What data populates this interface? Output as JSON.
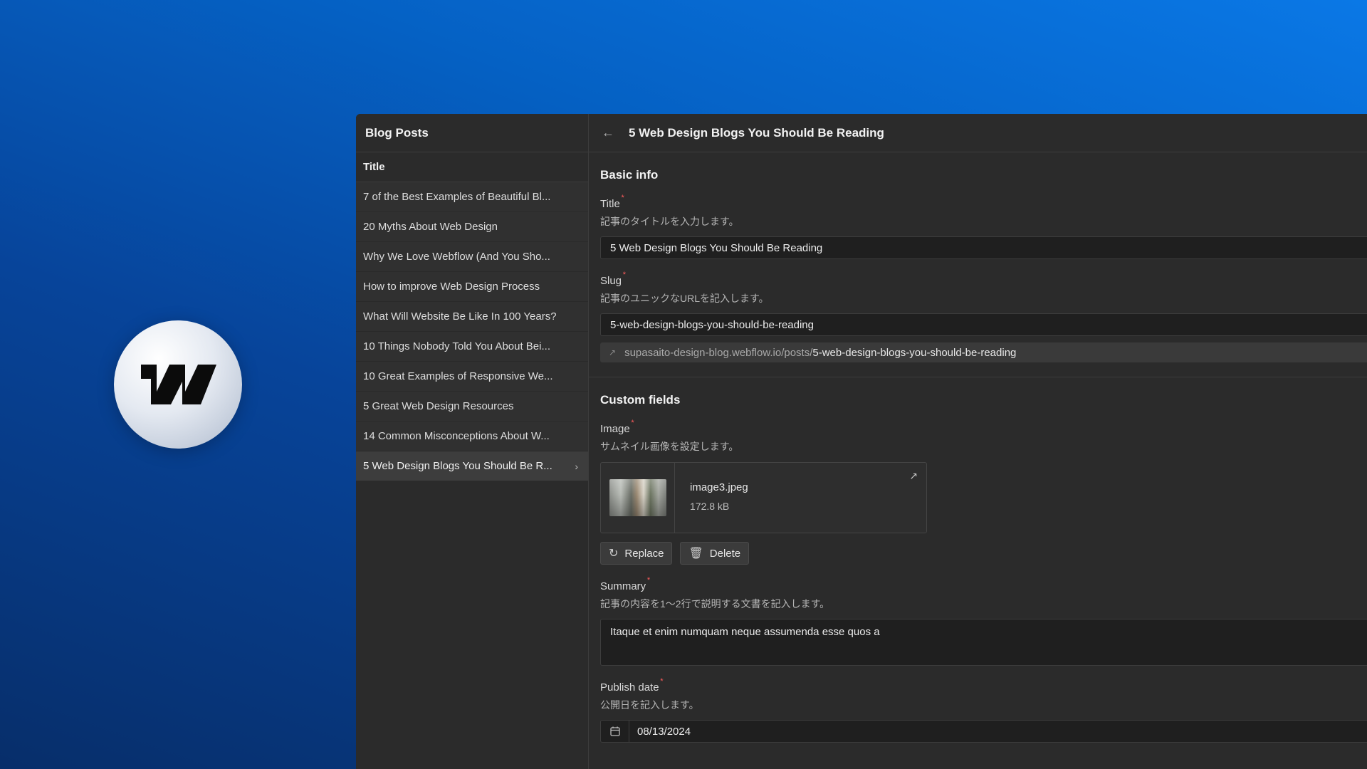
{
  "sidebar": {
    "title": "Blog Posts",
    "column_header": "Title",
    "items": [
      {
        "label": "7 of the Best Examples of Beautiful Bl..."
      },
      {
        "label": "20 Myths About Web Design"
      },
      {
        "label": "Why We Love Webflow (And You Sho..."
      },
      {
        "label": "How to improve Web Design Process"
      },
      {
        "label": "What Will Website Be Like In 100 Years?"
      },
      {
        "label": "10 Things Nobody Told You About Bei..."
      },
      {
        "label": "10 Great Examples of Responsive We..."
      },
      {
        "label": "5 Great Web Design Resources"
      },
      {
        "label": "14 Common Misconceptions About W..."
      },
      {
        "label": "5 Web Design Blogs You Should Be R..."
      }
    ],
    "selected_index": 9
  },
  "editor": {
    "title": "5 Web Design Blogs You Should Be Reading",
    "basic_info": {
      "heading": "Basic info",
      "title_field": {
        "label": "Title",
        "hint": "記事のタイトルを入力します。",
        "value": "5 Web Design Blogs You Should Be Reading"
      },
      "slug_field": {
        "label": "Slug",
        "hint": "記事のユニックなURLを記入します。",
        "value": "5-web-design-blogs-you-should-be-reading",
        "url_base": "supasaito-design-blog.webflow.io/posts/",
        "url_slug": "5-web-design-blogs-you-should-be-reading"
      }
    },
    "custom_fields": {
      "heading": "Custom fields",
      "image_field": {
        "label": "Image",
        "hint": "サムネイル画像を設定します。",
        "file_name": "image3.jpeg",
        "file_size": "172.8 kB",
        "replace_label": "Replace",
        "delete_label": "Delete"
      },
      "summary_field": {
        "label": "Summary",
        "hint": "記事の内容を1〜2行で説明する文書を記入します。",
        "value": "Itaque et enim numquam neque assumenda esse quos a"
      },
      "publish_date_field": {
        "label": "Publish date",
        "hint": "公開日を記入します。",
        "value": "08/13/2024"
      }
    },
    "required_marker": "*"
  },
  "colors": {
    "background_top": "#0a78e6",
    "background_bottom": "#072e6a",
    "panel": "#2b2b2b",
    "required": "#ff5c5c"
  },
  "icons": {
    "logo": "webflow-logo",
    "back": "arrow-left-icon",
    "chevron": "chevron-right-icon",
    "link": "link-icon",
    "open": "arrow-up-right-icon",
    "replace": "refresh-icon",
    "delete": "trash-icon",
    "calendar": "calendar-icon"
  }
}
